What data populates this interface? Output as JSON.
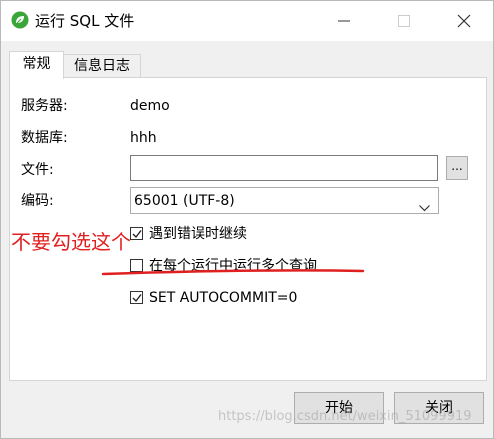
{
  "window": {
    "title": "运行 SQL 文件"
  },
  "tabs": [
    {
      "label": "常规",
      "active": true
    },
    {
      "label": "信息日志",
      "active": false
    }
  ],
  "form": {
    "server_label": "服务器:",
    "server_value": "demo",
    "database_label": "数据库:",
    "database_value": "hhh",
    "file_label": "文件:",
    "file_value": "",
    "browse_label": "...",
    "encoding_label": "编码:",
    "encoding_value": "65001 (UTF-8)"
  },
  "options": [
    {
      "label": "遇到错误时继续",
      "checked": true
    },
    {
      "label": "在每个运行中运行多个查询",
      "checked": false
    },
    {
      "label": "SET AUTOCOMMIT=0",
      "checked": true
    }
  ],
  "annotation": {
    "text": "不要勾选这个",
    "color": "#e02020"
  },
  "buttons": {
    "start": "开始",
    "close": "关闭"
  },
  "watermark": "https://blog.csdn.net/weixin_51099919",
  "colors": {
    "icon_green": "#3aa63a"
  },
  "icons": {
    "app": "navicat-leaf-icon",
    "minimize": "minimize-icon",
    "maximize": "maximize-icon",
    "close": "close-icon",
    "dropdown": "chevron-down-icon",
    "check": "check-icon"
  }
}
